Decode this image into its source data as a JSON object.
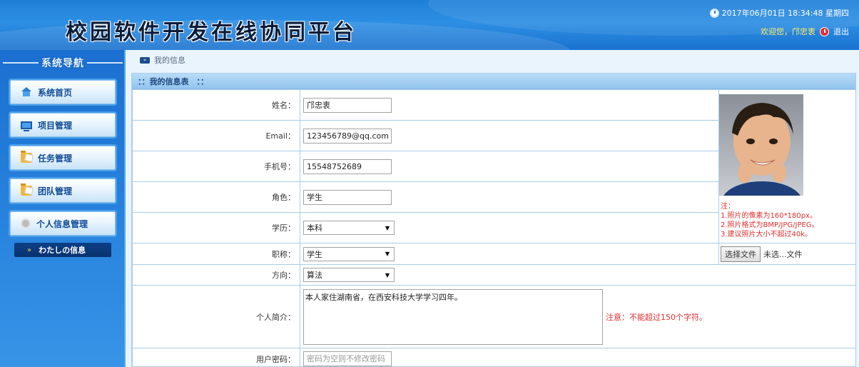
{
  "header": {
    "title": "校园软件开发在线协同平台",
    "datetime": "2017年06月01日 18:34:48 星期四",
    "welcome": "欢迎您，邝忠衷",
    "logout_label": "退出"
  },
  "sidebar": {
    "title": "系统导航",
    "items": [
      {
        "label": "系统首页",
        "icon": "home-icon"
      },
      {
        "label": "项目管理",
        "icon": "monitor-icon"
      },
      {
        "label": "任务管理",
        "icon": "folder-icon"
      },
      {
        "label": "团队管理",
        "icon": "folder-icon"
      },
      {
        "label": "个人信息管理",
        "icon": "avatar-icon"
      }
    ],
    "sub_item": {
      "arrow": "»",
      "label": "わたしの信息"
    }
  },
  "breadcrumb": {
    "label": "我的信息"
  },
  "panel": {
    "title": "：：我的信息表　：：",
    "fields": {
      "name": {
        "label": "姓名：",
        "value": "邝忠衷"
      },
      "email": {
        "label": "Email：",
        "value": "123456789@qq.com"
      },
      "phone": {
        "label": "手机号：",
        "value": "15548752689"
      },
      "role": {
        "label": "角色：",
        "value": "学生"
      },
      "education": {
        "label": "学历：",
        "value": "本科"
      },
      "title": {
        "label": "职称：",
        "value": "学生"
      },
      "direction": {
        "label": "方向：",
        "value": "算法"
      },
      "bio": {
        "label": "个人简介：",
        "value": "本人家住湖南省，在西安科技大学学习四年。",
        "note": "注意：不能超过150个字符。"
      },
      "password": {
        "label": "用户密码：",
        "placeholder": "密码为空则不修改密码"
      }
    },
    "photo": {
      "notes": [
        "注：",
        "1.照片的像素为160*180px。",
        "2.照片格式为BMP/JPG/JPEG。",
        "3.建议照片大小不超过40k。"
      ],
      "file_button": "选择文件",
      "file_status": "未选...文件"
    }
  },
  "colors": {
    "header_blue": "#2d8fe3",
    "sidebar_blue": "#2a85df",
    "note_red": "#e03030",
    "welcome_yellow": "#ffee66"
  }
}
